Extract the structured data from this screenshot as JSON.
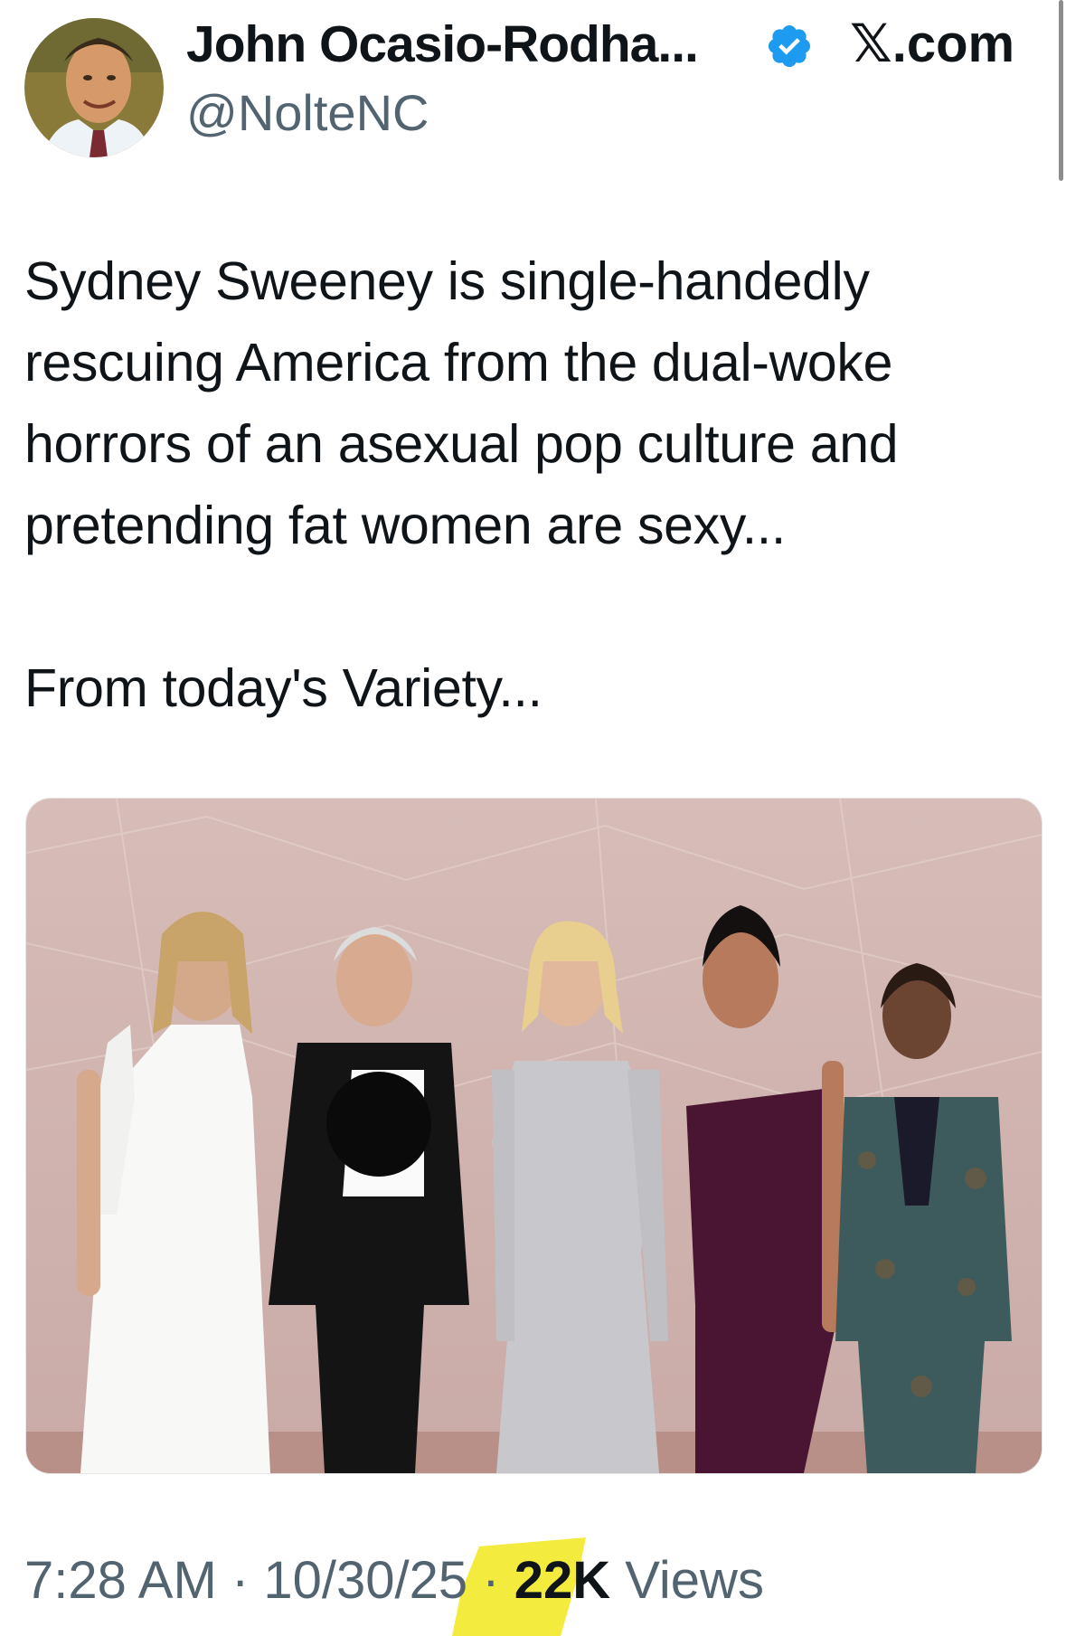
{
  "author": {
    "name": "John Ocasio-Rodha...",
    "handle": "@NolteNC",
    "verified": true,
    "verified_icon": "verified-badge-icon"
  },
  "source_site": "𝕏.com",
  "tweet": {
    "lines": [
      "Sydney Sweeney is single-handedly",
      "rescuing America from the dual-woke",
      "horrors of an asexual pop culture and",
      "pretending fat women are sexy...",
      "From today's Variety..."
    ]
  },
  "meta": {
    "time": "7:28 AM",
    "separator": "·",
    "date": "10/30/25",
    "views_count": "22K",
    "views_label": "Views"
  },
  "colors": {
    "text": "#0f1419",
    "secondary": "#536471",
    "verified": "#1d9bf0",
    "highlight": "#f2ea2a"
  }
}
